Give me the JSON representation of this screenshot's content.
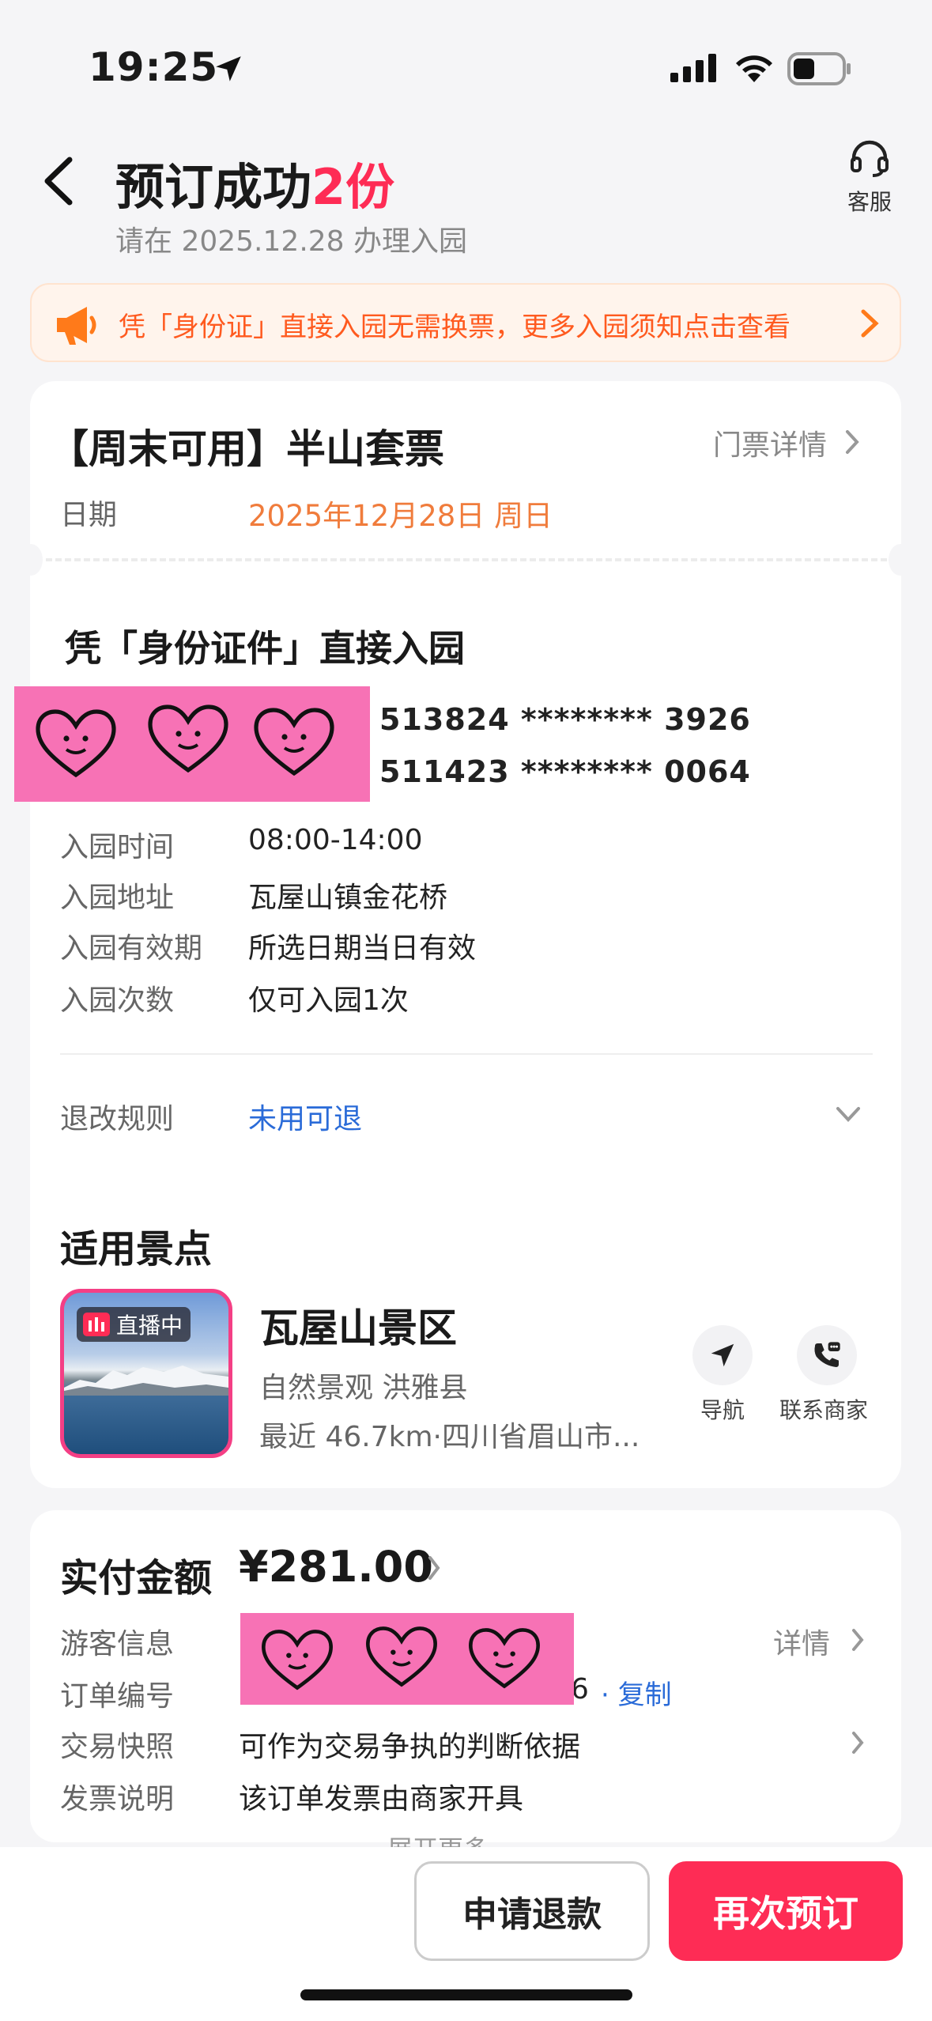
{
  "status_bar": {
    "time": "19:25"
  },
  "header": {
    "title": "预订成功",
    "title_count": "2份",
    "subtitle": "请在 2025.12.28 办理入园",
    "service_label": "客服"
  },
  "notice": {
    "text": "凭「身份证」直接入园无需换票，更多入园须知点击查看"
  },
  "ticket": {
    "name": "【周末可用】半山套票",
    "detail_link": "门票详情",
    "date_label": "日期",
    "date_value": "2025年12月28日 周日",
    "id_heading": "凭「身份证件」直接入园",
    "ids": [
      "513824 ******** 3926",
      "511423 ******** 0064"
    ],
    "info": [
      {
        "label": "入园时间",
        "value": "08:00-14:00"
      },
      {
        "label": "入园地址",
        "value": "瓦屋山镇金花桥"
      },
      {
        "label": "入园有效期",
        "value": "所选日期当日有效"
      },
      {
        "label": "入园次数",
        "value": "仅可入园1次"
      }
    ],
    "refund_label": "退改规则",
    "refund_value": "未用可退"
  },
  "attraction": {
    "heading": "适用景点",
    "live_badge": "直播中",
    "name": "瓦屋山景区",
    "tags": "自然景观  洪雅县",
    "distance": "最近 46.7km·四川省眉山市...",
    "nav_label": "导航",
    "contact_label": "联系商家"
  },
  "order": {
    "pay_label": "实付金额",
    "pay_value": "¥281.00",
    "rows": [
      {
        "label": "游客信息",
        "value": ""
      },
      {
        "label": "订单编号",
        "value": ""
      },
      {
        "label": "交易快照",
        "value": "可作为交易争执的判断依据"
      },
      {
        "label": "发票说明",
        "value": "该订单发票由商家开具"
      }
    ],
    "detail_link": "详情",
    "order_tail": "6",
    "copy_link": "· 复制",
    "expand_more": "展开更多"
  },
  "actions": {
    "refund_button": "申请退款",
    "rebook_button": "再次预订"
  },
  "colors": {
    "accent": "#fe2c55",
    "orange": "#f07c3c",
    "link_blue": "#2a6bd8",
    "sticker_pink": "#f772b5"
  }
}
